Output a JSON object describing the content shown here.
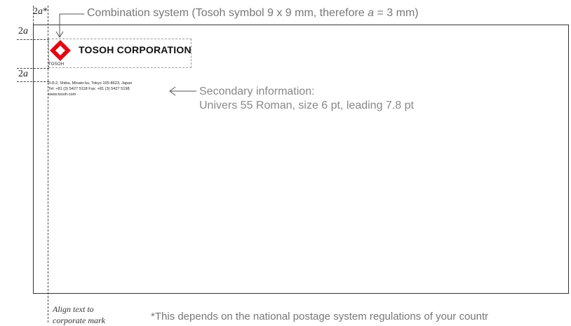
{
  "dimensions": {
    "top_label_num": "2",
    "top_label_var": "a",
    "top_label_star": "*",
    "left_label_1_num": "2",
    "left_label_1_var": "a",
    "left_label_2_num": "2",
    "left_label_2_var": "a"
  },
  "callouts": {
    "combination_pre": "Combination system (Tosoh symbol 9 x 9 mm, therefore ",
    "combination_var": "a",
    "combination_post": " = 3 mm)",
    "secondary_line1": "Secondary information:",
    "secondary_line2": "Univers 55 Roman, size 6 pt, leading 7.8 pt"
  },
  "logo": {
    "name": "TOSOH CORPORATION",
    "small": "TOSOH",
    "color": "#e30613"
  },
  "address": {
    "line1": "3-8-2, Shiba, Minato-ku, Tokyo 105-8623, Japan",
    "line2": "Tel: +81 (3) 5427 5118  Fax: +81 (3) 5427 5198",
    "line3": "www.tosoh.com"
  },
  "notes": {
    "align_line1": "Align text to",
    "align_line2": "corporate mark",
    "footnote": "*This depends on the national postage system regulations of your countr"
  }
}
